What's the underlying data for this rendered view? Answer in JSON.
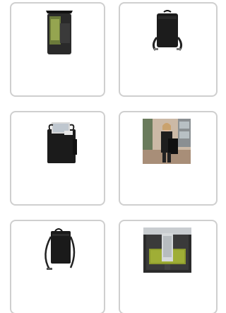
{
  "products": [
    {
      "image": "laptop-bag-open-top-view"
    },
    {
      "image": "backpack-black-straps"
    },
    {
      "image": "laptop-tote-with-laptop"
    },
    {
      "image": "woman-carrying-tote-lifestyle"
    },
    {
      "image": "tote-with-shoulder-strap"
    },
    {
      "image": "bag-interior-lime-lining"
    }
  ]
}
